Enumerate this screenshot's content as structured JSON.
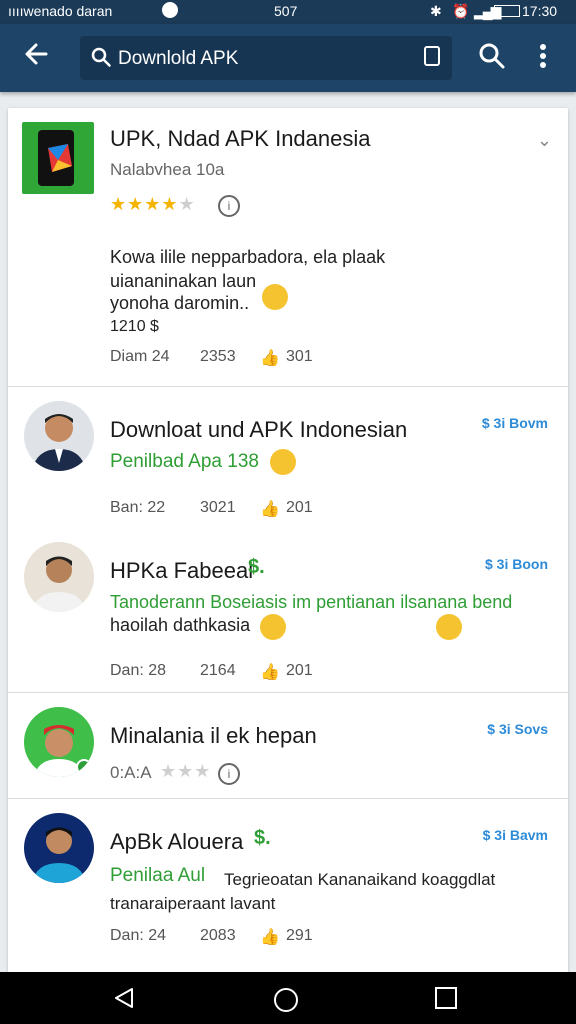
{
  "status": {
    "left": "ııııwenado daran",
    "center": "507",
    "time": "17:30"
  },
  "search": {
    "query": "Downlold APK"
  },
  "items": [
    {
      "title": "UPK, Ndad APK Indanesia",
      "developer": "Nalabvhea 10a",
      "rating": 4,
      "description_lines": [
        "Kowa ilile nepparbadora, ela plaak",
        "uiananinakan laun",
        "yonoha daromin..",
        "1210 $"
      ],
      "meta": {
        "date": "Diam 24",
        "downloads": "2353",
        "likes": "301"
      }
    },
    {
      "title": "Downloat und APK Indonesian",
      "subtitle": "Penilbad Apa 138",
      "price": "$ 3i Bovm",
      "meta": {
        "date": "Ban: 22",
        "downloads": "3021",
        "likes": "201"
      }
    },
    {
      "title": "HPKa Fabeeal",
      "subtitle": "Tanoderann Boseiasis im pentianan ilsanana bend",
      "subtitle2": "haoilah dathkasia",
      "price": "$ 3i Boon",
      "meta": {
        "date": "Dan: 28",
        "downloads": "2164",
        "likes": "201"
      }
    },
    {
      "title": "Minalania il ek hepan",
      "developer": "0:A:A",
      "rating": 2,
      "price": "$ 3i Sovs",
      "meta": {}
    },
    {
      "title": "ApBk Alouera",
      "subtitle": "Penilaa Aul",
      "body": "Tegrieoatan Kananaikand koaggdlat",
      "body2": "tranaraiperaant lavant",
      "price": "$ 3i Bavm",
      "meta": {
        "date": "Dan: 24",
        "downloads": "2083",
        "likes": "291"
      }
    }
  ],
  "colors": {
    "appbar": "#1e4467",
    "green": "#2f9e35",
    "accent": "#2d8bd8",
    "star": "#f4b400"
  }
}
